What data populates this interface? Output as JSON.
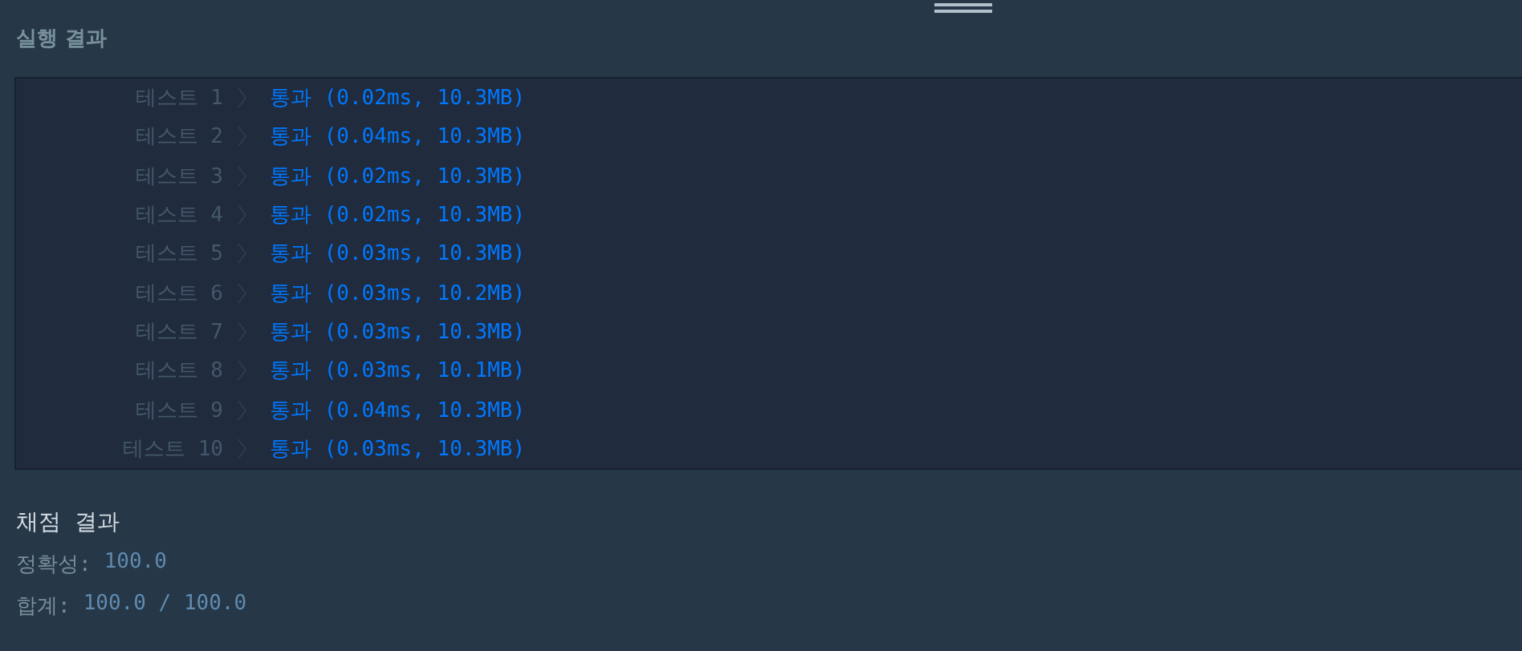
{
  "header": {
    "title": "실행 결과"
  },
  "tests": [
    {
      "label": "테스트 1",
      "result": "통과 (0.02ms, 10.3MB)"
    },
    {
      "label": "테스트 2",
      "result": "통과 (0.04ms, 10.3MB)"
    },
    {
      "label": "테스트 3",
      "result": "통과 (0.02ms, 10.3MB)"
    },
    {
      "label": "테스트 4",
      "result": "통과 (0.02ms, 10.3MB)"
    },
    {
      "label": "테스트 5",
      "result": "통과 (0.03ms, 10.3MB)"
    },
    {
      "label": "테스트 6",
      "result": "통과 (0.03ms, 10.2MB)"
    },
    {
      "label": "테스트 7",
      "result": "통과 (0.03ms, 10.3MB)"
    },
    {
      "label": "테스트 8",
      "result": "통과 (0.03ms, 10.1MB)"
    },
    {
      "label": "테스트 9",
      "result": "통과 (0.04ms, 10.3MB)"
    },
    {
      "label": "테스트 10",
      "result": "통과 (0.03ms, 10.3MB)"
    }
  ],
  "grading": {
    "title": "채점 결과",
    "lines": [
      {
        "label": "정확성:",
        "value": "100.0"
      },
      {
        "label": "합계:",
        "value": "100.0 / 100.0"
      }
    ]
  }
}
